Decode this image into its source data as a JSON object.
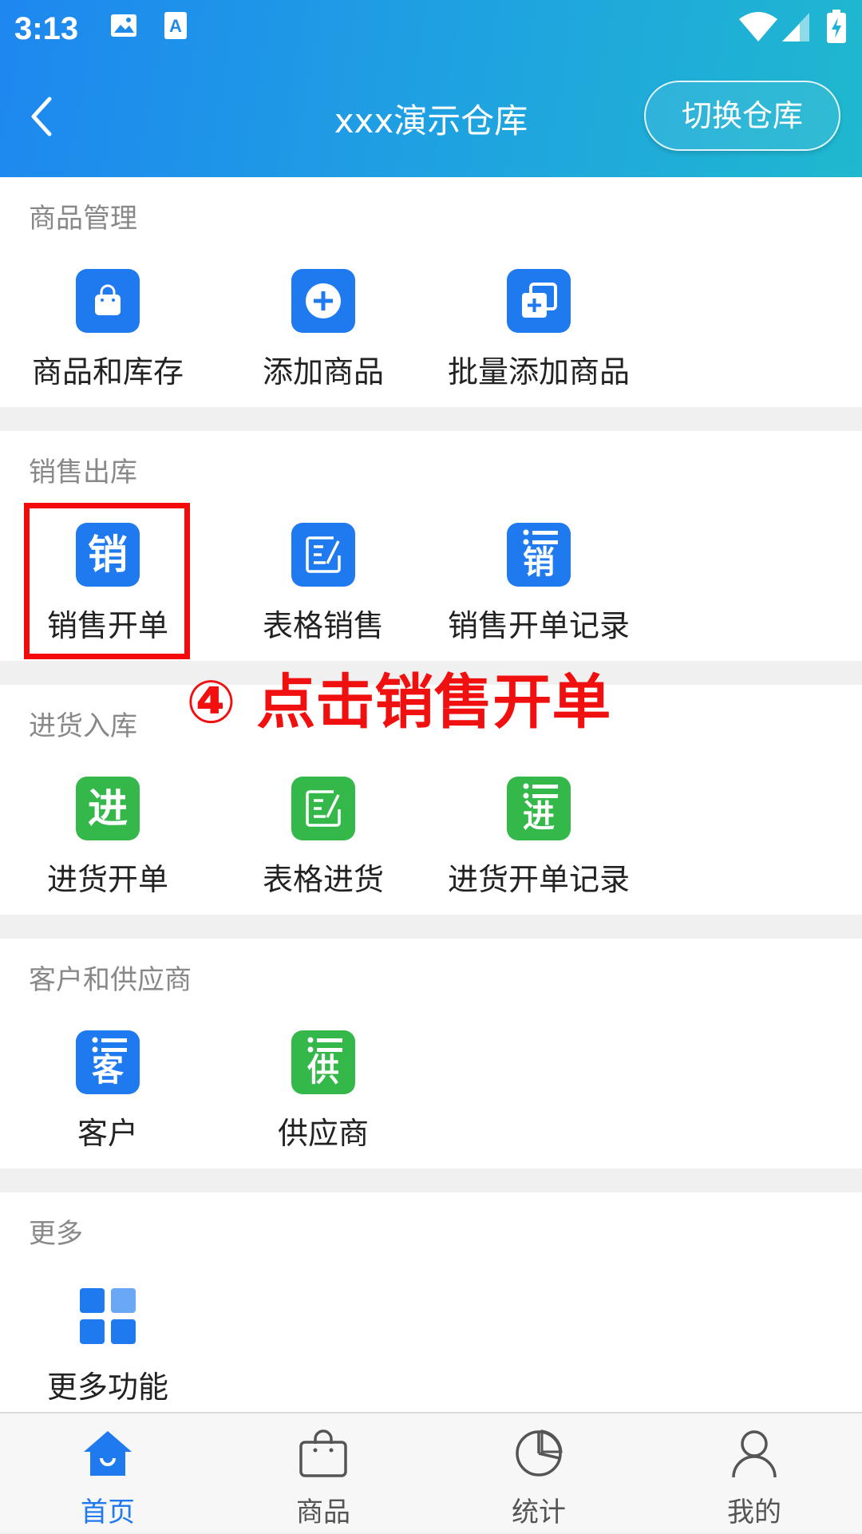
{
  "status_bar": {
    "time": "3:13"
  },
  "header": {
    "title": "xxx演示仓库",
    "switch_label": "切换仓库"
  },
  "sections": [
    {
      "title": "商品管理",
      "items": [
        "商品和库存",
        "添加商品",
        "批量添加商品"
      ]
    },
    {
      "title": "销售出库",
      "items": [
        "销售开单",
        "表格销售",
        "销售开单记录"
      ],
      "icon_chars": [
        "销",
        "",
        "销"
      ]
    },
    {
      "title": "进货入库",
      "items": [
        "进货开单",
        "表格进货",
        "进货开单记录"
      ],
      "icon_chars": [
        "进",
        "",
        "进"
      ]
    },
    {
      "title": "客户和供应商",
      "items": [
        "客户",
        "供应商"
      ],
      "icon_chars": [
        "客",
        "供"
      ]
    },
    {
      "title": "更多",
      "items": [
        "更多功能"
      ]
    }
  ],
  "annotation": "④ 点击销售开单",
  "tabs": [
    {
      "label": "首页",
      "active": true
    },
    {
      "label": "商品",
      "active": false
    },
    {
      "label": "统计",
      "active": false
    },
    {
      "label": "我的",
      "active": false
    }
  ],
  "colors": {
    "accent": "#1f7af0",
    "purchase": "#34b84a",
    "annotation": "#f01010"
  }
}
